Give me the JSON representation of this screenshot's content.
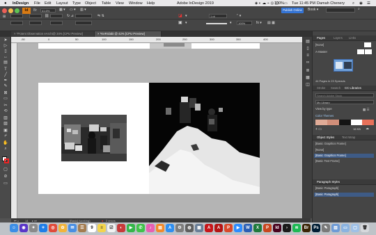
{
  "menubar": {
    "apple": "",
    "app_name": "InDesign",
    "items": [
      "File",
      "Edit",
      "Layout",
      "Type",
      "Object",
      "Table",
      "View",
      "Window",
      "Help"
    ],
    "window_title": "Adobe InDesign 2019",
    "battery": "100%",
    "datetime": "Tue 11:45 PM",
    "user": "Damah Chenery"
  },
  "control": {
    "zoom": "41.6%",
    "publish_online": "Publish Online",
    "workspace": "Book",
    "stroke_weight": "1 pt",
    "percent": "100%",
    "measure": "4.233 mm"
  },
  "doc_tabs": [
    {
      "label": "*Potent Observation eArchi@ 34% [CPU Preview]",
      "close": "×"
    },
    {
      "label": "*KeRrdabi @ 42% [CPU Preview]",
      "close": "×",
      "active": true
    }
  ],
  "ruler": {
    "labels": [
      "-50",
      "0",
      "50",
      "100",
      "150",
      "200",
      "250",
      "300",
      "350",
      "400"
    ]
  },
  "status": {
    "page": "14",
    "style": "[Basic] (working)",
    "errors": "2 errors"
  },
  "pages_panel": {
    "tabs": [
      "Pages",
      "Layers",
      "Links"
    ],
    "none_label": "[None]",
    "master_label": "A-Master",
    "footer": "44 Pages in 23 Spreads"
  },
  "libraries": {
    "tabs": [
      "Stroke",
      "Swatch",
      "CC Libraries"
    ],
    "search_placeholder": "Search Adobe Stock",
    "library_name": "My Library",
    "view_by": "View by type",
    "section": "Color Themes",
    "theme_colors": [
      "#e0ab97",
      "#d18e79",
      "#141414",
      "#ffffff",
      "#e7715a"
    ],
    "size_label": "16 KB"
  },
  "object_styles": {
    "tabs": [
      "Object Styles",
      "Text Wrap"
    ],
    "header": "[Basic Graphics Frame]",
    "items": [
      "[None]",
      "[Basic Graphics Frame]",
      "[Basic Text Frame]"
    ],
    "selected_index": 1
  },
  "paragraph_styles": {
    "tab": "Paragraph Styles",
    "header": "[Basic Paragraph]",
    "items": [
      "[Basic Paragraph]"
    ],
    "selected_index": 0
  },
  "dock": {
    "apps": [
      {
        "name": "Finder",
        "color": "#3b8ee6",
        "glyph": "☺"
      },
      {
        "name": "Siri",
        "color": "#5a36c8",
        "glyph": "◉"
      },
      {
        "name": "Launchpad",
        "color": "#8a8a8a",
        "glyph": "✦"
      },
      {
        "name": "Safari",
        "color": "#1f7ee8",
        "glyph": "✧"
      },
      {
        "name": "Chrome",
        "color": "#e04a3a",
        "glyph": "◎"
      },
      {
        "name": "Photos",
        "color": "#f2b43b",
        "glyph": "✿"
      },
      {
        "name": "Mail",
        "color": "#4a8fe2",
        "glyph": "✉"
      },
      {
        "name": "Contacts",
        "color": "#a47c4f",
        "glyph": "☰"
      },
      {
        "name": "Calendar",
        "color": "#ffffff",
        "glyph": "9"
      },
      {
        "name": "Notes",
        "color": "#f3d44c",
        "glyph": "≡"
      },
      {
        "name": "Reminders",
        "color": "#f2f2f2",
        "glyph": "☑"
      },
      {
        "name": "Photo Booth",
        "color": "#c83a3a",
        "glyph": "◐"
      },
      {
        "name": "FaceTime",
        "color": "#34b64a",
        "glyph": "▶"
      },
      {
        "name": "Messages",
        "color": "#40c24a",
        "glyph": "✆"
      },
      {
        "name": "iTunes",
        "color": "#e85fb3",
        "glyph": "♪"
      },
      {
        "name": "iBooks",
        "color": "#f18a2b",
        "glyph": "▤"
      },
      {
        "name": "App Store",
        "color": "#2f8ff0",
        "glyph": "A"
      },
      {
        "name": "System Preferences",
        "color": "#7d7d7d",
        "glyph": "⚙"
      },
      {
        "name": "Image Capture",
        "color": "#5f5f5f",
        "glyph": "◍"
      },
      {
        "name": "Preview",
        "color": "#6a7f98",
        "glyph": "▦"
      },
      {
        "name": "Acrobat",
        "color": "#c7161b",
        "glyph": "A"
      },
      {
        "name": "Acrobat Reader",
        "color": "#b41414",
        "glyph": "A"
      },
      {
        "name": "Presentation",
        "color": "#d9482b",
        "glyph": "P"
      },
      {
        "name": "Zoom",
        "color": "#2d8cff",
        "glyph": "▶"
      },
      {
        "name": "Word",
        "color": "#2a5fb5",
        "glyph": "W"
      },
      {
        "name": "Excel",
        "color": "#1e7a3c",
        "glyph": "X"
      },
      {
        "name": "PowerPoint",
        "color": "#c8461f",
        "glyph": "P"
      },
      {
        "name": "InDesign",
        "color": "#49021f",
        "glyph": "Id"
      },
      {
        "name": "Terminal",
        "color": "#1a1a1a",
        "glyph": "›"
      },
      {
        "name": "Spotify",
        "color": "#1db954",
        "glyph": "≋"
      },
      {
        "name": "Bridge",
        "color": "#3a2506",
        "glyph": "Br"
      },
      {
        "name": "Photoshop",
        "color": "#001d34",
        "glyph": "Ps"
      },
      {
        "name": "Script Editor",
        "color": "#7a7a7a",
        "glyph": "✎"
      },
      {
        "name": "Downloads",
        "color": "#6e9bd6",
        "glyph": "▥"
      },
      {
        "name": "Folder",
        "color": "#8bb3e0",
        "glyph": "▭"
      },
      {
        "name": "Finder Window",
        "color": "#9fc0e6",
        "glyph": "▢"
      },
      {
        "name": "Trash",
        "color": "#d6d8dc",
        "glyph": "🗑"
      }
    ]
  }
}
